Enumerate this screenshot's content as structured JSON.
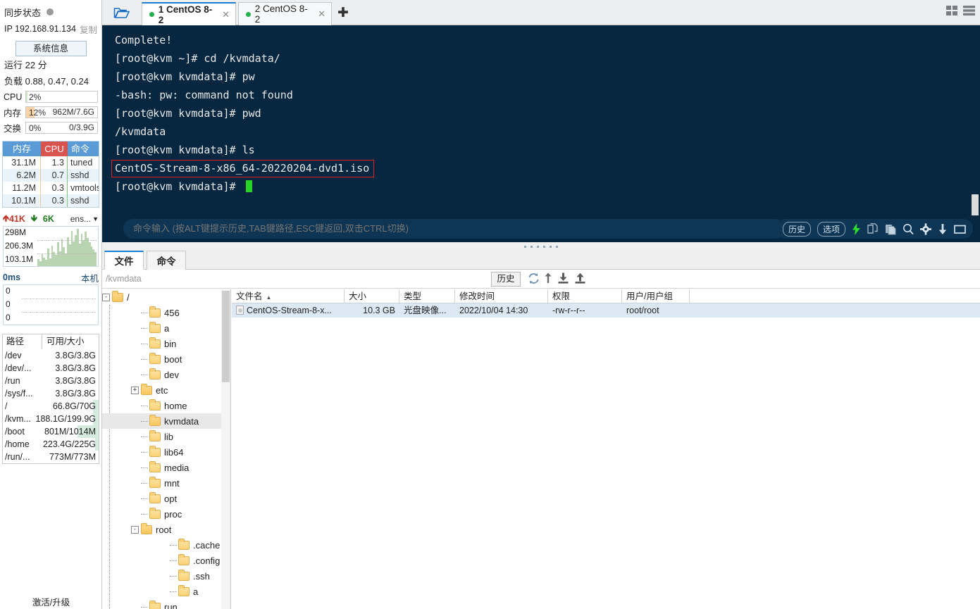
{
  "sidebar": {
    "sync_label": "同步状态",
    "ip_label": "IP 192.168.91.134",
    "copy_label": "复制",
    "sysinfo_button": "系统信息",
    "uptime": "运行 22 分",
    "load": "负载 0.88, 0.47, 0.24",
    "stats": [
      {
        "label": "CPU",
        "value": "2%",
        "right": "",
        "percent": 2,
        "color": "#cdeac0"
      },
      {
        "label": "内存",
        "value": "12%",
        "right": "962M/7.6G",
        "percent": 12,
        "color": "#fbd3a6"
      },
      {
        "label": "交换",
        "value": "0%",
        "right": "0/3.9G",
        "percent": 0,
        "color": "#cdeac0"
      }
    ],
    "proc_headers": {
      "mem": "内存",
      "cpu": "CPU",
      "cmd": "命令"
    },
    "processes": [
      {
        "mem": "31.1M",
        "cpu": "1.3",
        "cmd": "tuned"
      },
      {
        "mem": "6.2M",
        "cpu": "0.7",
        "cmd": "sshd"
      },
      {
        "mem": "11.2M",
        "cpu": "0.3",
        "cmd": "vmtools"
      },
      {
        "mem": "10.1M",
        "cpu": "0.3",
        "cmd": "sshd"
      }
    ],
    "network": {
      "up": "41K",
      "down": "6K",
      "iface": "ens...",
      "y_labels": [
        "298M",
        "206.3M",
        "103.1M"
      ],
      "bars": [
        18,
        12,
        30,
        22,
        16,
        45,
        20,
        52,
        35,
        28,
        60,
        38,
        70,
        48,
        32,
        74,
        55,
        90,
        62,
        78,
        95,
        58,
        82,
        66,
        88,
        72,
        60,
        50,
        42,
        36
      ]
    },
    "latency": {
      "value": "0ms",
      "host": "本机",
      "y_labels": [
        "0",
        "0",
        "0"
      ]
    },
    "disk_headers": {
      "path": "路径",
      "size": "可用/大小"
    },
    "disks": [
      {
        "path": "/dev",
        "size": "3.8G/3.8G",
        "fill": 0
      },
      {
        "path": "/dev/...",
        "size": "3.8G/3.8G",
        "fill": 0
      },
      {
        "path": "/run",
        "size": "3.8G/3.8G",
        "fill": 0
      },
      {
        "path": "/sys/f...",
        "size": "3.8G/3.8G",
        "fill": 0
      },
      {
        "path": "/",
        "size": "66.8G/70G",
        "fill": 6
      },
      {
        "path": "/kvm...",
        "size": "188.1G/199.9G",
        "fill": 6
      },
      {
        "path": "/boot",
        "size": "801M/1014M",
        "fill": 22
      },
      {
        "path": "/home",
        "size": "223.4G/225G",
        "fill": 4
      },
      {
        "path": "/run/...",
        "size": "773M/773M",
        "fill": 0
      }
    ],
    "activate": "激活/升级"
  },
  "tabbar": {
    "folder_icon": "folder-open-icon",
    "tabs": [
      {
        "label": "1 CentOS 8-2",
        "active": true,
        "close": "✕"
      },
      {
        "label": "2 CentOS 8-2",
        "active": false,
        "close": "✕"
      }
    ],
    "add_tab": "✚",
    "right_icons": [
      "grid-view-icon",
      "list-view-icon"
    ]
  },
  "terminal": {
    "lines": [
      {
        "text": "Complete!",
        "highlight": false
      },
      {
        "text": "[root@kvm ~]# cd /kvmdata/",
        "highlight": false
      },
      {
        "text": "[root@kvm kvmdata]# pw",
        "highlight": false
      },
      {
        "text": "-bash: pw: command not found",
        "highlight": false
      },
      {
        "text": "[root@kvm kvmdata]# pwd",
        "highlight": false
      },
      {
        "text": "/kvmdata",
        "highlight": false
      },
      {
        "text": "[root@kvm kvmdata]# ls",
        "highlight": false
      },
      {
        "text": "CentOS-Stream-8-x86_64-20220204-dvd1.iso",
        "highlight": true
      },
      {
        "text": "[root@kvm kvmdata]# ",
        "highlight": false,
        "cursor": true
      }
    ],
    "background": "#06273f",
    "text_color": "#e8e8e8",
    "highlight_color": "#e02020",
    "cursor_color": "#25d625"
  },
  "command_bar": {
    "placeholder": "命令输入 (按ALT键提示历史,TAB键路径,ESC键返回,双击CTRL切换)",
    "value": "",
    "history_button": "历史",
    "options_button": "选项",
    "icons": [
      "lightning-icon",
      "copy-icon",
      "paste-icon",
      "search-icon",
      "gear-icon",
      "download-icon",
      "window-icon"
    ]
  },
  "file_panel": {
    "tabs": [
      {
        "label": "文件",
        "active": true
      },
      {
        "label": "命令",
        "active": false
      }
    ],
    "path": "/kvmdata",
    "history_button": "历史",
    "toolbar_icons": [
      "refresh-icon",
      "up-arrow-icon",
      "download-icon",
      "upload-icon"
    ],
    "tree": [
      {
        "label": "/",
        "depth": 0,
        "expander": "-",
        "selected": false,
        "open": true
      },
      {
        "label": "456",
        "depth": 1,
        "expander": "",
        "selected": false
      },
      {
        "label": "a",
        "depth": 1,
        "expander": "",
        "selected": false
      },
      {
        "label": "bin",
        "depth": 1,
        "expander": "",
        "selected": false,
        "link": true
      },
      {
        "label": "boot",
        "depth": 1,
        "expander": "",
        "selected": false
      },
      {
        "label": "dev",
        "depth": 1,
        "expander": "",
        "selected": false
      },
      {
        "label": "etc",
        "depth": 1,
        "expander": "+",
        "selected": false,
        "open": true
      },
      {
        "label": "home",
        "depth": 1,
        "expander": "",
        "selected": false
      },
      {
        "label": "kvmdata",
        "depth": 1,
        "expander": "",
        "selected": true,
        "open": true
      },
      {
        "label": "lib",
        "depth": 1,
        "expander": "",
        "selected": false,
        "link": true
      },
      {
        "label": "lib64",
        "depth": 1,
        "expander": "",
        "selected": false,
        "link": true
      },
      {
        "label": "media",
        "depth": 1,
        "expander": "",
        "selected": false
      },
      {
        "label": "mnt",
        "depth": 1,
        "expander": "",
        "selected": false
      },
      {
        "label": "opt",
        "depth": 1,
        "expander": "",
        "selected": false
      },
      {
        "label": "proc",
        "depth": 1,
        "expander": "",
        "selected": false
      },
      {
        "label": "root",
        "depth": 1,
        "expander": "-",
        "selected": false,
        "open": true
      },
      {
        "label": ".cache",
        "depth": 2,
        "expander": "",
        "selected": false
      },
      {
        "label": ".config",
        "depth": 2,
        "expander": "",
        "selected": false
      },
      {
        "label": ".ssh",
        "depth": 2,
        "expander": "",
        "selected": false
      },
      {
        "label": "a",
        "depth": 2,
        "expander": "",
        "selected": false
      },
      {
        "label": "run",
        "depth": 1,
        "expander": "",
        "selected": false
      }
    ],
    "columns": [
      "文件名",
      "大小",
      "类型",
      "修改时间",
      "权限",
      "用户/用户组"
    ],
    "sort_column": "文件名",
    "sort_caret": "▲",
    "rows": [
      {
        "name": "CentOS-Stream-8-x...",
        "size": "10.3 GB",
        "type": "光盘映像...",
        "time": "2022/10/04 14:30",
        "perm": "-rw-r--r--",
        "owner": "root/root"
      }
    ]
  }
}
